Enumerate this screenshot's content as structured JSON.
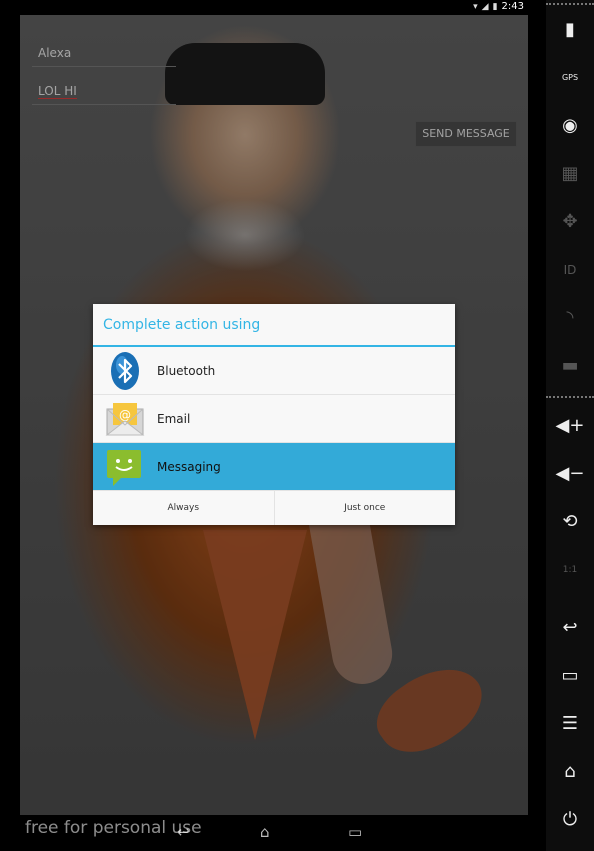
{
  "status": {
    "time": "2:43",
    "icons": [
      "wifi-icon",
      "signal-icon",
      "battery-icon"
    ]
  },
  "app": {
    "recipient_value": "Alexa",
    "message_value": "LOL HI",
    "send_label": "SEND MESSAGE"
  },
  "dialog": {
    "title": "Complete action using",
    "options": [
      {
        "label": "Bluetooth",
        "icon": "bluetooth-icon"
      },
      {
        "label": "Email",
        "icon": "email-icon"
      },
      {
        "label": "Messaging",
        "icon": "messaging-icon",
        "selected": true
      }
    ],
    "always_label": "Always",
    "just_once_label": "Just once",
    "accent": "#33b5e5",
    "selected_bg": "#33aad8"
  },
  "watermark": "free for personal use",
  "side_toolbar": {
    "items": [
      "battery-icon",
      "gps-icon",
      "webcam-icon",
      "clapper-icon",
      "dpad-icon",
      "id-icon",
      "rss-icon",
      "sms-icon",
      "volume-up-icon",
      "volume-down-icon",
      "rotate-icon",
      "scale-icon",
      "back-icon",
      "recents-icon",
      "menu-icon",
      "home-icon",
      "power-icon"
    ],
    "gps_label": "GPS",
    "id_label": "ID",
    "scale_label": "1:1"
  }
}
